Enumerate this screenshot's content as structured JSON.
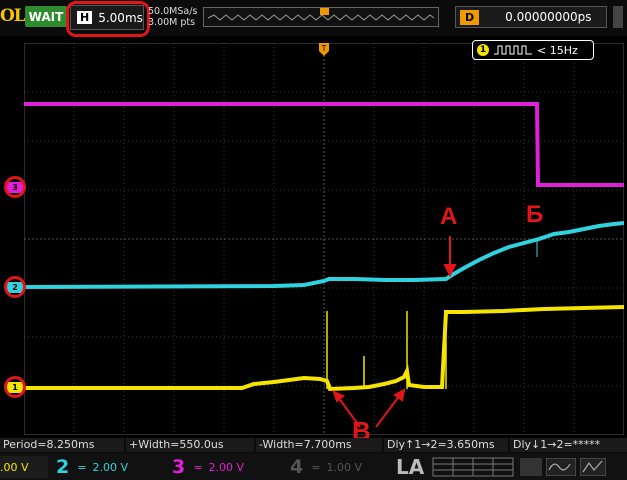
{
  "header": {
    "brand": "OL",
    "status": "WAIT",
    "timebase_label": "H",
    "timebase_value": "5.00ms",
    "sample_rate": "50.0MSa/s",
    "memory_depth": "3.00M pts",
    "delay_label": "D",
    "delay_value": "0.00000000ps"
  },
  "trigger": {
    "marker": "T",
    "channel": "1",
    "frequency": "< 15Hz"
  },
  "channels": {
    "ch1_marker": "1",
    "ch2_marker": "2",
    "ch3_marker": "3"
  },
  "annotations": {
    "a_label": "А",
    "b_label": "Б",
    "v_label": "В"
  },
  "measurements": {
    "period": "Period=8.250ms",
    "pos_width": "+Width=550.0us",
    "neg_width": "-Width=7.700ms",
    "delay_1": "Dly↑1→2=3.650ms",
    "delay_2": "Dly↓1→2=*****"
  },
  "channel_bar": {
    "ch1_scale": ".00 V",
    "ch2_num": "2",
    "ch2_scale": "2.00 V",
    "ch3_num": "3",
    "ch3_scale": "2.00 V",
    "ch4_num": "4",
    "ch4_scale": "1.00 V",
    "la_label": "LA"
  },
  "colors": {
    "ch1": "#f5e400",
    "ch2": "#2fd3e0",
    "ch3": "#e020d8",
    "grid": "#3a3a3a",
    "annotation": "#e0161b"
  }
}
